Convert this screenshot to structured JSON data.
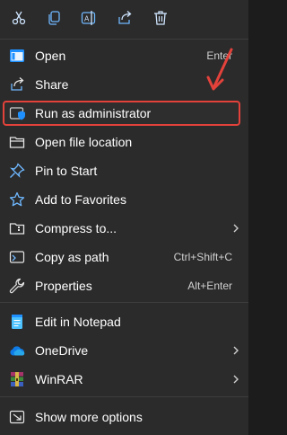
{
  "toolbar": {
    "buttons": [
      {
        "icon": "cut-icon"
      },
      {
        "icon": "copy-icon"
      },
      {
        "icon": "rename-icon"
      },
      {
        "icon": "share-icon"
      },
      {
        "icon": "delete-icon"
      }
    ]
  },
  "menu": {
    "open": {
      "label": "Open",
      "shortcut": "Enter",
      "icon": "app-window-icon"
    },
    "share": {
      "label": "Share",
      "icon": "share-icon"
    },
    "run_as_admin": {
      "label": "Run as administrator",
      "icon": "shield-icon"
    },
    "open_location": {
      "label": "Open file location",
      "icon": "folder-icon"
    },
    "pin_start": {
      "label": "Pin to Start",
      "icon": "pin-icon"
    },
    "add_favorites": {
      "label": "Add to Favorites",
      "icon": "star-icon"
    },
    "compress": {
      "label": "Compress to...",
      "icon": "archive-folder-icon"
    },
    "copy_path": {
      "label": "Copy as path",
      "shortcut": "Ctrl+Shift+C",
      "icon": "path-icon"
    },
    "properties": {
      "label": "Properties",
      "shortcut": "Alt+Enter",
      "icon": "wrench-icon"
    },
    "edit_notepad": {
      "label": "Edit in Notepad",
      "icon": "notepad-icon"
    },
    "onedrive": {
      "label": "OneDrive",
      "icon": "cloud-icon"
    },
    "winrar": {
      "label": "WinRAR",
      "icon": "winrar-icon"
    },
    "show_more": {
      "label": "Show more options",
      "icon": "more-options-icon"
    }
  },
  "colors": {
    "background": "#2b2b2b",
    "highlight_border": "#e3423b",
    "accent_blue": "#4cc2ff"
  }
}
